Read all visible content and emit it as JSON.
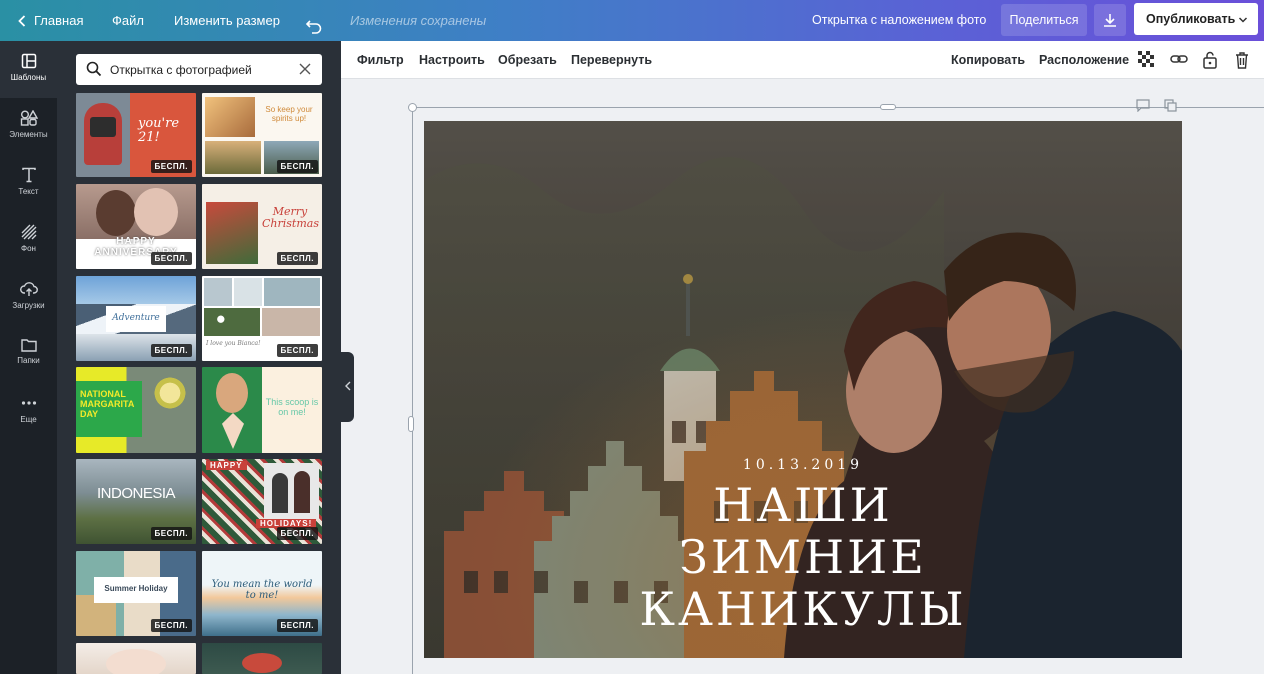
{
  "topbar": {
    "home_label": "Главная",
    "file_label": "Файл",
    "resize_label": "Изменить размер",
    "saved_status": "Изменения сохранены",
    "doc_title": "Открытка с наложением фото",
    "share_label": "Поделиться",
    "publish_label": "Опубликовать"
  },
  "rail": [
    {
      "label": "Шаблоны",
      "icon": "templates-icon"
    },
    {
      "label": "Элементы",
      "icon": "elements-icon"
    },
    {
      "label": "Текст",
      "icon": "text-icon"
    },
    {
      "label": "Фон",
      "icon": "background-icon"
    },
    {
      "label": "Загрузки",
      "icon": "uploads-icon"
    },
    {
      "label": "Папки",
      "icon": "folder-icon"
    },
    {
      "label": "Еще",
      "icon": "more-icon"
    }
  ],
  "search": {
    "value": "Открытка с фотографией"
  },
  "free_badge": "БЕСПЛ.",
  "thumbs": {
    "t1": "you're 21!",
    "t2": "So keep your spirits up!",
    "t3": "HAPPY ANNIVERSARY",
    "t4": "Merry Christmas",
    "t5": "Adventure",
    "t6": "I love you Bianca!",
    "t7": "NATIONAL MARGARITA DAY",
    "t8": "This scoop is on me!",
    "t9": "INDONESIA",
    "t10_top": "HAPPY",
    "t10_bottom": "HOLIDAYS!",
    "t11": "Summer Holiday",
    "t12": "You mean the world to me!"
  },
  "toolbar2": {
    "filter": "Фильтр",
    "adjust": "Настроить",
    "crop": "Обрезать",
    "flip": "Перевернуть",
    "copy": "Копировать",
    "arrange": "Расположение"
  },
  "canvas": {
    "date": "10.13.2019",
    "title_line1": "НАШИ",
    "title_line2": "ЗИМНИЕ",
    "title_line3": "КАНИКУЛЫ"
  }
}
